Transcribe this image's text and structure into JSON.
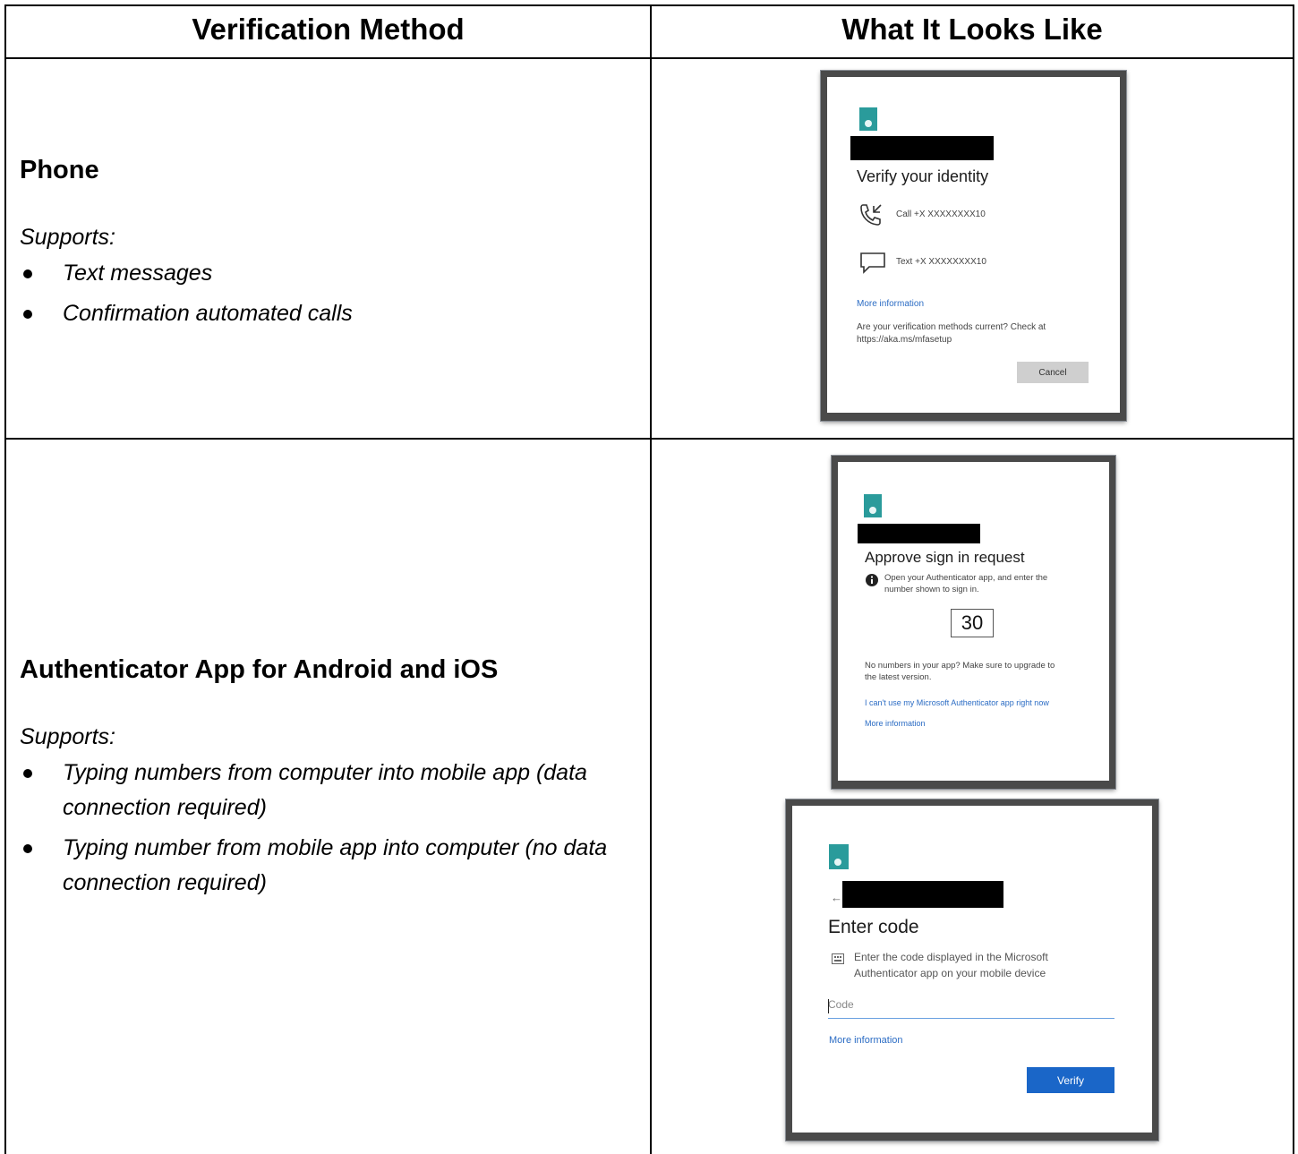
{
  "table": {
    "headers": [
      "Verification Method",
      "What It Looks Like"
    ],
    "rows": [
      {
        "method": "Phone",
        "supports_label": "Supports:",
        "supports": [
          "Text messages",
          "Confirmation automated calls"
        ]
      },
      {
        "method": "Authenticator App for Android and iOS",
        "supports_label": "Supports:",
        "supports": [
          "Typing numbers from computer into mobile app (data connection required)",
          "Typing number from mobile app into computer (no data connection required)"
        ]
      }
    ]
  },
  "screens": {
    "phone": {
      "title": "Verify your identity",
      "call_option": "Call +X XXXXXXXX10",
      "text_option": "Text +X XXXXXXXX10",
      "more_info": "More information",
      "current_line1": "Are your verification methods current? Check at",
      "current_line2": "https://aka.ms/mfasetup",
      "cancel": "Cancel"
    },
    "approve": {
      "title": "Approve sign in request",
      "instruction_line1": "Open your Authenticator app, and enter the",
      "instruction_line2": "number shown to sign in.",
      "number": "30",
      "upgrade_line1": "No numbers in your app? Make sure to upgrade to",
      "upgrade_line2": "the latest version.",
      "cant_use": "I can't use my Microsoft Authenticator app right now",
      "more_info": "More information"
    },
    "enter_code": {
      "back_arrow": "←",
      "title": "Enter code",
      "instruction_line1": "Enter the code displayed in the Microsoft",
      "instruction_line2": "Authenticator app on your mobile device",
      "placeholder": "Code",
      "more_info": "More information",
      "verify": "Verify"
    }
  },
  "colors": {
    "logo": "#2a9b9b",
    "link": "#2b6cc4",
    "verify_button": "#1a66c8"
  }
}
